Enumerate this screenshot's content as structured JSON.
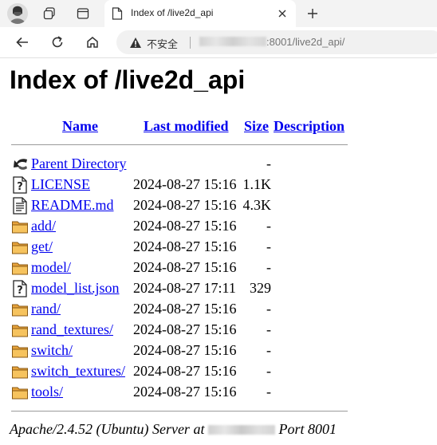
{
  "browser": {
    "tab_title": "Index of /live2d_api",
    "security_label": "不安全",
    "url_suffix": ":8001/live2d_api/"
  },
  "page": {
    "title": "Index of /live2d_api",
    "headers": {
      "name": "Name",
      "modified": "Last modified",
      "size": "Size",
      "description": "Description"
    },
    "rows": [
      {
        "icon": "back-icon",
        "name": "Parent Directory",
        "modified": "",
        "size": "-"
      },
      {
        "icon": "unknown-file-icon",
        "name": "LICENSE",
        "modified": "2024-08-27 15:16",
        "size": "1.1K"
      },
      {
        "icon": "text-file-icon",
        "name": "README.md",
        "modified": "2024-08-27 15:16",
        "size": "4.3K"
      },
      {
        "icon": "folder-icon",
        "name": "add/",
        "modified": "2024-08-27 15:16",
        "size": "-"
      },
      {
        "icon": "folder-icon",
        "name": "get/",
        "modified": "2024-08-27 15:16",
        "size": "-"
      },
      {
        "icon": "folder-icon",
        "name": "model/",
        "modified": "2024-08-27 15:16",
        "size": "-"
      },
      {
        "icon": "unknown-file-icon",
        "name": "model_list.json",
        "modified": "2024-08-27 17:11",
        "size": "329"
      },
      {
        "icon": "folder-icon",
        "name": "rand/",
        "modified": "2024-08-27 15:16",
        "size": "-"
      },
      {
        "icon": "folder-icon",
        "name": "rand_textures/",
        "modified": "2024-08-27 15:16",
        "size": "-"
      },
      {
        "icon": "folder-icon",
        "name": "switch/",
        "modified": "2024-08-27 15:16",
        "size": "-"
      },
      {
        "icon": "folder-icon",
        "name": "switch_textures/",
        "modified": "2024-08-27 15:16",
        "size": "-"
      },
      {
        "icon": "folder-icon",
        "name": "tools/",
        "modified": "2024-08-27 15:16",
        "size": "-"
      }
    ],
    "footer_prefix": "Apache/2.4.52 (Ubuntu) Server at",
    "footer_suffix": "Port 8001"
  }
}
